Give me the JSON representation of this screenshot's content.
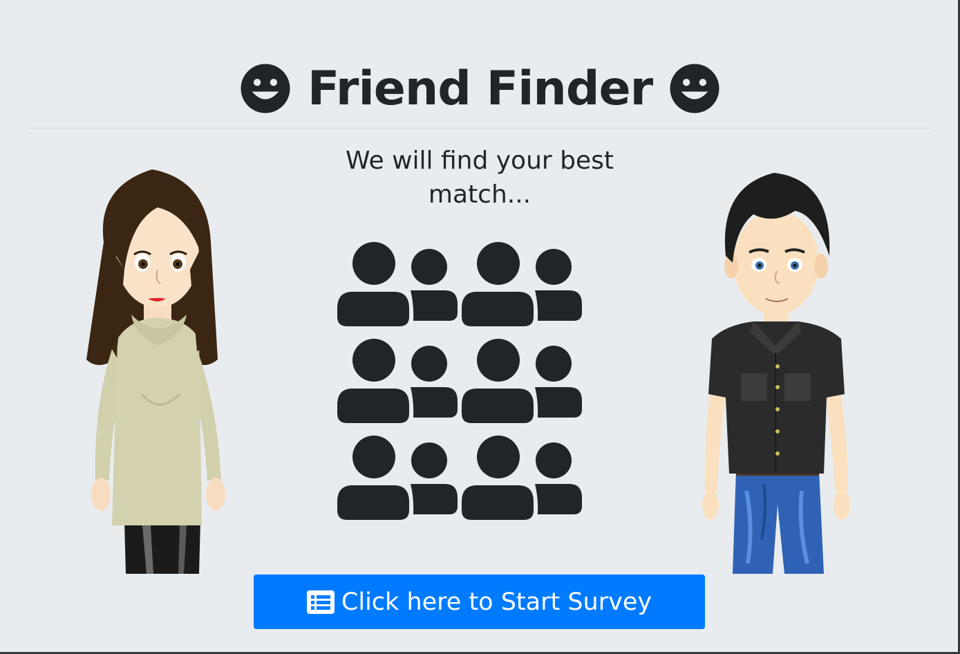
{
  "header": {
    "title": "Friend Finder",
    "left_icon": "smile-icon",
    "right_icon": "smile-icon"
  },
  "hero": {
    "subtitle": "We will find your best match...",
    "illustration_icon": "users-icon",
    "left_avatar": "cartoon-woman",
    "right_avatar": "cartoon-man"
  },
  "survey_button": {
    "label": "Click here to Start Survey",
    "icon": "list-icon",
    "color": "#007bff"
  },
  "colors": {
    "background": "#e9ecef",
    "text": "#212529"
  }
}
